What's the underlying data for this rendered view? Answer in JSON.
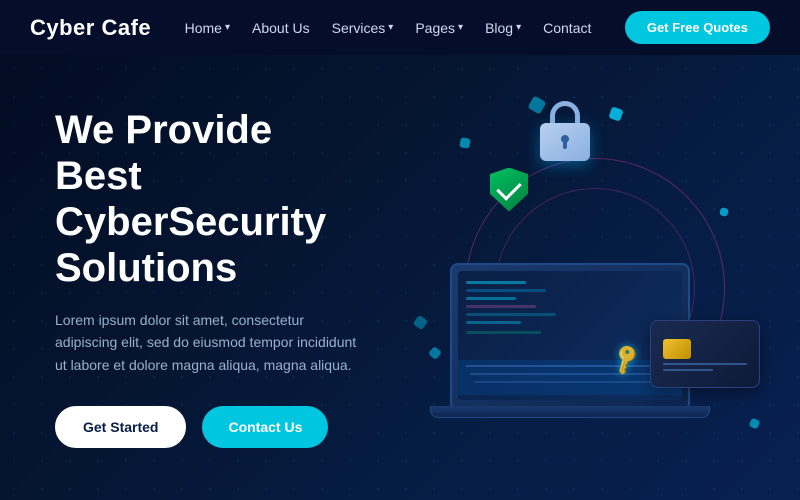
{
  "brand": {
    "name": "Cyber Cafe"
  },
  "nav": {
    "links": [
      {
        "label": "Home",
        "hasDropdown": true
      },
      {
        "label": "About Us",
        "hasDropdown": false
      },
      {
        "label": "Services",
        "hasDropdown": true
      },
      {
        "label": "Pages",
        "hasDropdown": true
      },
      {
        "label": "Blog",
        "hasDropdown": true
      },
      {
        "label": "Contact",
        "hasDropdown": false
      }
    ],
    "cta_label": "Get Free Quotes"
  },
  "hero": {
    "title": "We Provide Best CyberSecurity Solutions",
    "description": "Lorem ipsum dolor sit amet, consectetur adipiscing elit, sed do eiusmod tempor incididunt ut labore et dolore magna aliqua, magna aliqua.",
    "btn_started": "Get Started",
    "btn_contact": "Contact Us"
  }
}
